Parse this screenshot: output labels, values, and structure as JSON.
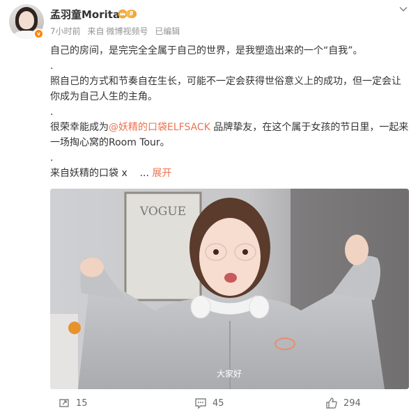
{
  "post": {
    "username": "孟羽童Morita",
    "vip_level": "Ⅱ",
    "meta": {
      "time": "7小时前",
      "source_prefix": "来自",
      "source": "微博视频号",
      "edited": "已编辑"
    },
    "paragraphs": {
      "p1": "自己的房间，是完完全全属于自己的世界，是我塑造出来的一个“自我”。",
      "p2": "照自己的方式和节奏自在生长，可能不一定会获得世俗意义上的成功，但一定会让你成为自己人生的主角。",
      "p3_before": "很荣幸能成为",
      "p3_mention": "@妖精的口袋ELFSACK",
      "p3_after": " 品牌挚友，在这个属于女孩的节日里，一起来一场掏心窝的Room Tour。",
      "p4": "来自妖精的口袋 x",
      "ellipsis": "...",
      "expand": "展开",
      "dot": "."
    },
    "video": {
      "subtitle": "大家好",
      "poster_text": "VOGUE"
    }
  },
  "actions": {
    "repost_count": "15",
    "comment_count": "45",
    "like_count": "294"
  },
  "colors": {
    "link": "#eb7350",
    "verified": "#ff8200",
    "meta": "#939393"
  },
  "icons": [
    "verified-icon",
    "vip-crown-icon",
    "chevron-down-icon",
    "repost-icon",
    "comment-icon",
    "like-icon"
  ]
}
